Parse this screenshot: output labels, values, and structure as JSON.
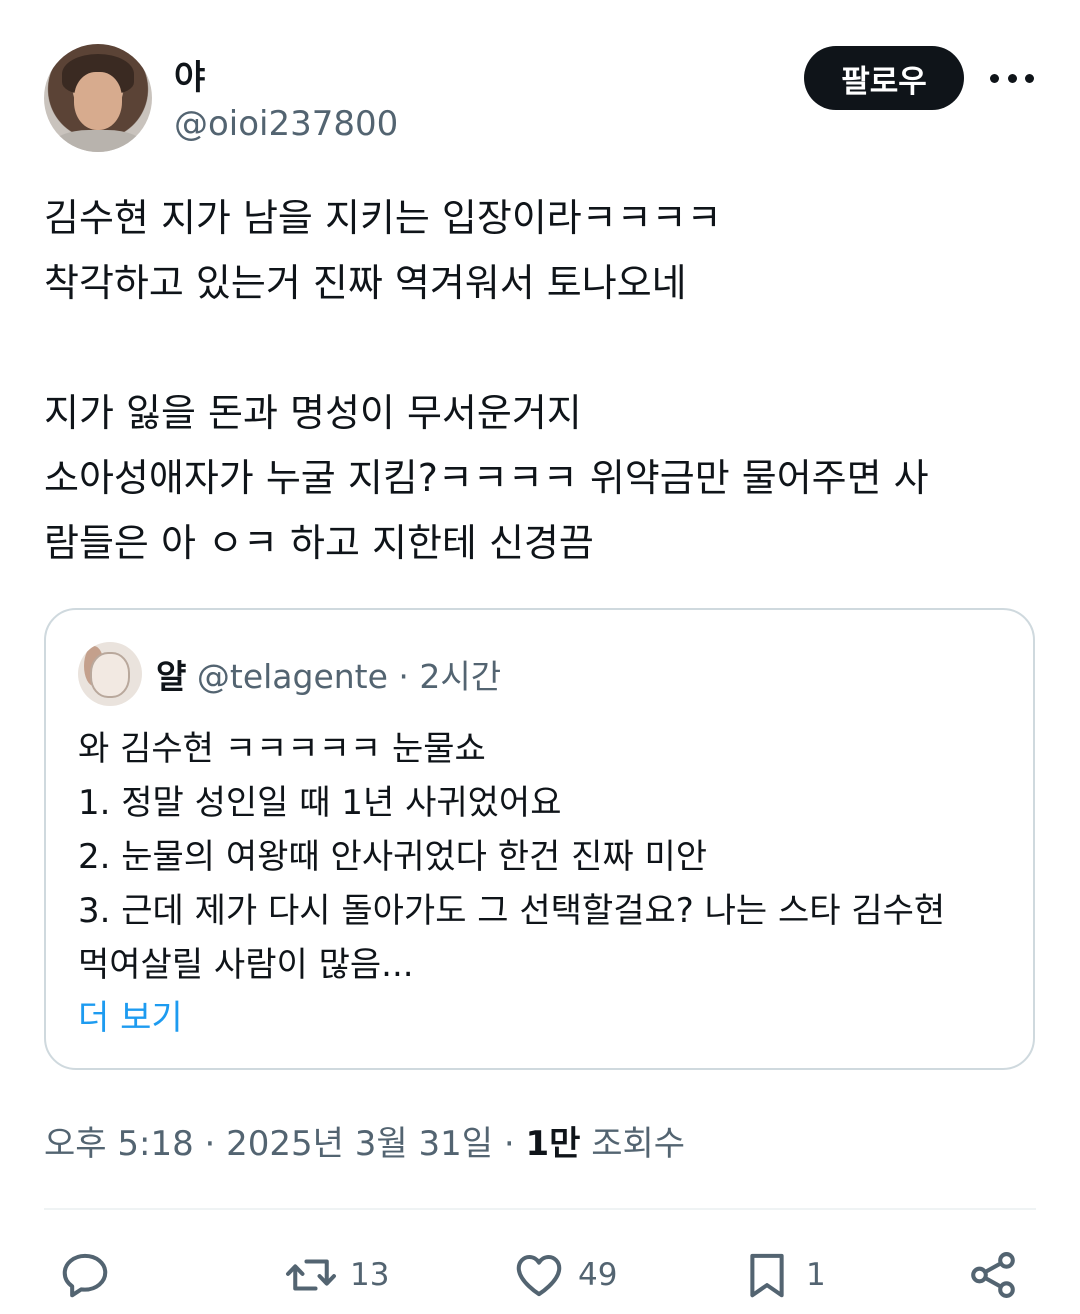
{
  "author": {
    "display_name": "야",
    "handle": "@oioi237800"
  },
  "follow_label": "팔로우",
  "tweet_lines": [
    "김수현 지가 남을 지키는 입장이라ㅋㅋㅋㅋ",
    "착각하고 있는거 진짜 역겨워서 토나오네",
    "",
    "지가 잃을 돈과 명성이 무서운거지",
    "소아성애자가 누굴 지킴?ㅋㅋㅋㅋ 위약금만 물어주면 사",
    "람들은 아 ㅇㅋ 하고 지한테 신경끔"
  ],
  "quote": {
    "display_name": "얄",
    "handle": "@telagente",
    "separator": " · ",
    "time": "2시간",
    "lines": [
      "와 김수현 ㅋㅋㅋㅋㅋ 눈물쇼",
      "1. 정말 성인일 때 1년 사귀었어요",
      "2. 눈물의 여왕때 안사귀었다 한건 진짜 미안",
      "3. 근데 제가 다시 돌아가도 그 선택할걸요? 나는 스타 김수현",
      "먹여살릴 사람이 많음..."
    ],
    "show_more": "더 보기"
  },
  "meta": {
    "time": "오후 5:18",
    "date": "2025년 3월 31일",
    "separator": " · ",
    "views_count": "1만",
    "views_label": " 조회수"
  },
  "actions": {
    "reply_count": "",
    "retweet_count": "13",
    "like_count": "49",
    "bookmark_count": "1"
  },
  "icons": [
    "more-icon",
    "reply-icon",
    "retweet-icon",
    "like-icon",
    "bookmark-icon",
    "share-icon"
  ],
  "colors": {
    "text": "#0f1419",
    "secondary": "#536471",
    "link": "#1d9bf0",
    "border": "#cfd9de"
  }
}
